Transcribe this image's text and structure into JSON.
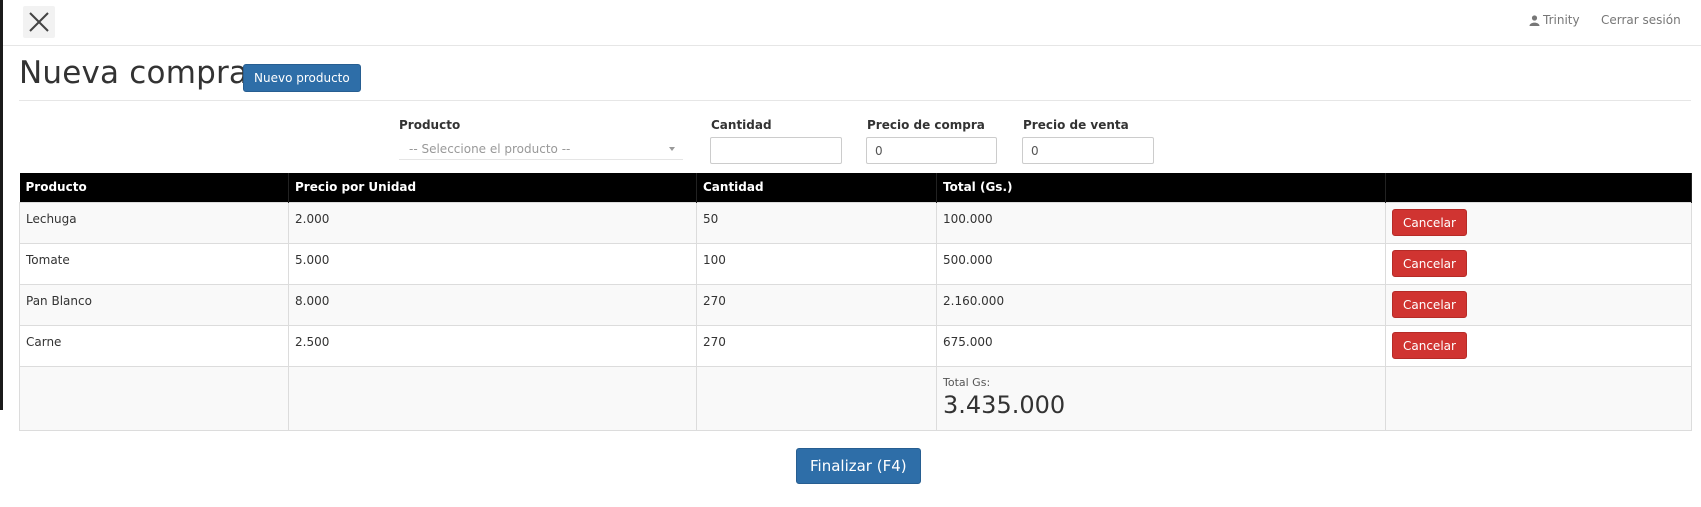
{
  "header": {
    "close_icon": "close-icon",
    "user_icon": "user-icon",
    "user_name": "Trinity",
    "logout_label": "Cerrar sesión"
  },
  "page": {
    "title": "Nueva compra",
    "new_product_label": "Nuevo producto"
  },
  "form": {
    "product_label": "Producto",
    "product_placeholder": "-- Seleccione el producto --",
    "quantity_label": "Cantidad",
    "quantity_value": "",
    "purchase_price_label": "Precio de compra",
    "purchase_price_value": "0",
    "sale_price_label": "Precio de venta",
    "sale_price_value": "0"
  },
  "table": {
    "headers": [
      "Producto",
      "Precio por Unidad",
      "Cantidad",
      "Total (Gs.)",
      ""
    ],
    "rows": [
      {
        "product": "Lechuga",
        "unit_price": "2.000",
        "quantity": "50",
        "total": "100.000",
        "action": "Cancelar"
      },
      {
        "product": "Tomate",
        "unit_price": "5.000",
        "quantity": "100",
        "total": "500.000",
        "action": "Cancelar"
      },
      {
        "product": "Pan Blanco",
        "unit_price": "8.000",
        "quantity": "270",
        "total": "2.160.000",
        "action": "Cancelar"
      },
      {
        "product": "Carne",
        "unit_price": "2.500",
        "quantity": "270",
        "total": "675.000",
        "action": "Cancelar"
      }
    ],
    "total_label": "Total Gs:",
    "total_value": "3.435.000"
  },
  "footer": {
    "finish_label": "Finalizar (F4)"
  },
  "colors": {
    "primary": "#2e6ea8",
    "danger": "#d03431",
    "header_bg": "#000000"
  }
}
